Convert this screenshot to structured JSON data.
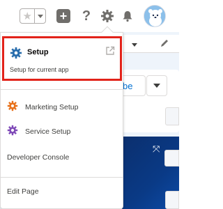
{
  "header": {
    "favorite_star_icon": "star-icon",
    "add_icon_glyph": "+",
    "help_icon_glyph": "?",
    "setup_gear_icon": "gear-icon",
    "notifications_icon": "bell-icon",
    "avatar_icon": "user-avatar"
  },
  "background": {
    "subscribe_fragment": "be",
    "expand_icon_glyph": "⤧"
  },
  "menu": {
    "setup": {
      "title": "Setup",
      "subtitle": "Setup for current app",
      "icon": "gear-icon",
      "external_icon": "external-link-icon"
    },
    "items": [
      {
        "label": "Marketing Setup",
        "icon": "gear-icon",
        "color": "#e8721c"
      },
      {
        "label": "Service Setup",
        "icon": "gear-icon",
        "color": "#7f4ab8"
      }
    ],
    "developer_console": "Developer Console",
    "edit_page": "Edit Page"
  },
  "colors": {
    "setup_gear": "#2a6ead",
    "highlight_border": "#e2231a",
    "link_blue": "#0070d2"
  }
}
